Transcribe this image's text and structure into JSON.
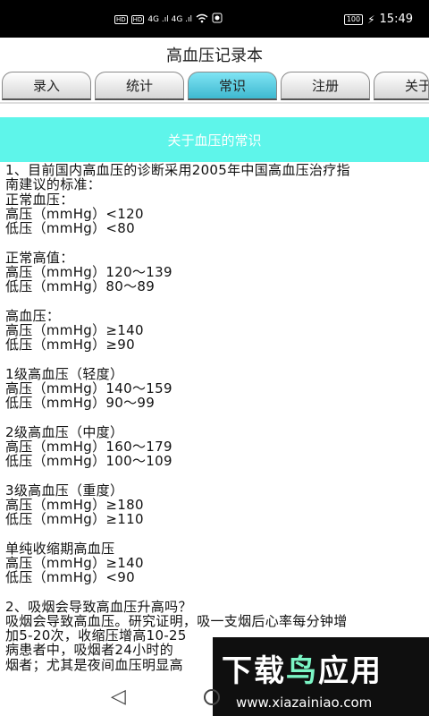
{
  "status_bar": {
    "hd1": "HD",
    "hd2": "HD",
    "signal": "4G .ıl 4G .ıl",
    "battery": "100",
    "time": "15:49"
  },
  "app": {
    "title": "高血压记录本"
  },
  "tabs": [
    {
      "label": "录入",
      "active": false
    },
    {
      "label": "统计",
      "active": false
    },
    {
      "label": "常识",
      "active": true
    },
    {
      "label": "注册",
      "active": false
    },
    {
      "label": "关于",
      "active": false
    }
  ],
  "section": {
    "title": "关于血压的常识"
  },
  "content_lines": [
    "1、目前国内高血压的诊断采用2005年中国高血压治疗指",
    "南建议的标准：",
    "正常血压：",
    "高压（mmHg）<120",
    "低压（mmHg）<80",
    "",
    "正常高值：",
    "高压（mmHg）120～139",
    "低压（mmHg）80～89",
    "",
    "高血压：",
    "高压（mmHg）≥140",
    "低压（mmHg）≥90",
    "",
    "1级高血压（轻度）",
    "高压（mmHg）140～159",
    "低压（mmHg）90～99",
    "",
    "2级高血压（中度）",
    "高压（mmHg）160～179",
    "低压（mmHg）100～109",
    "",
    "3级高血压（重度）",
    "高压（mmHg）≥180",
    "低压（mmHg）≥110",
    "",
    "单纯收缩期高血压",
    "高压（mmHg）≥140",
    "低压（mmHg）<90",
    "",
    "2、吸烟会导致高血压升高吗？",
    "吸烟会导致高血压。研究证明，吸一支烟后心率每分钟增",
    "加5-20次，收缩压增高10-25",
    "病患者中，吸烟者24小时的",
    "烟者；尤其是夜间血压明显高"
  ],
  "watermark": {
    "title_a": "下载",
    "title_b": "鸟",
    "title_c": "应用",
    "url": "www.xiazainiao.com"
  },
  "nav": {
    "back": "◁"
  }
}
